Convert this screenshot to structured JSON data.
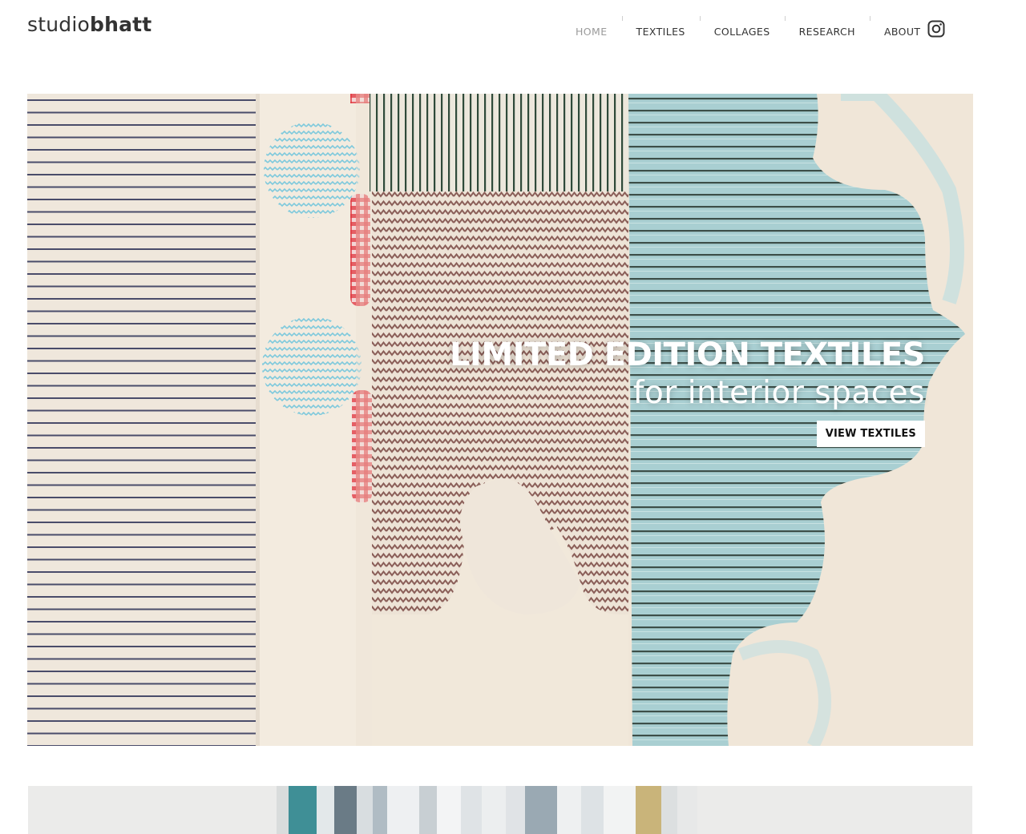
{
  "site": {
    "logo_light": "studio",
    "logo_bold": "bhatt"
  },
  "nav": {
    "items": [
      {
        "label": "HOME",
        "active": true
      },
      {
        "label": "TEXTILES",
        "active": false
      },
      {
        "label": "COLLAGES",
        "active": false
      },
      {
        "label": "RESEARCH",
        "active": false
      },
      {
        "label": "ABOUT",
        "active": false
      }
    ],
    "social_icon": "instagram-icon"
  },
  "hero": {
    "title": "LIMITED EDITION TEXTILES",
    "subtitle": "for interior spaces",
    "button_label": "VIEW TEXTILES"
  },
  "colors": {
    "fabric": "#f1e8da",
    "stripe_navy": "#4a4c6a",
    "zigzag_blue": "#7ec9dc",
    "zigzag_brown": "#8a5e58",
    "stripe_green": "#2f4a3a",
    "gingham_red": "#e03840"
  }
}
